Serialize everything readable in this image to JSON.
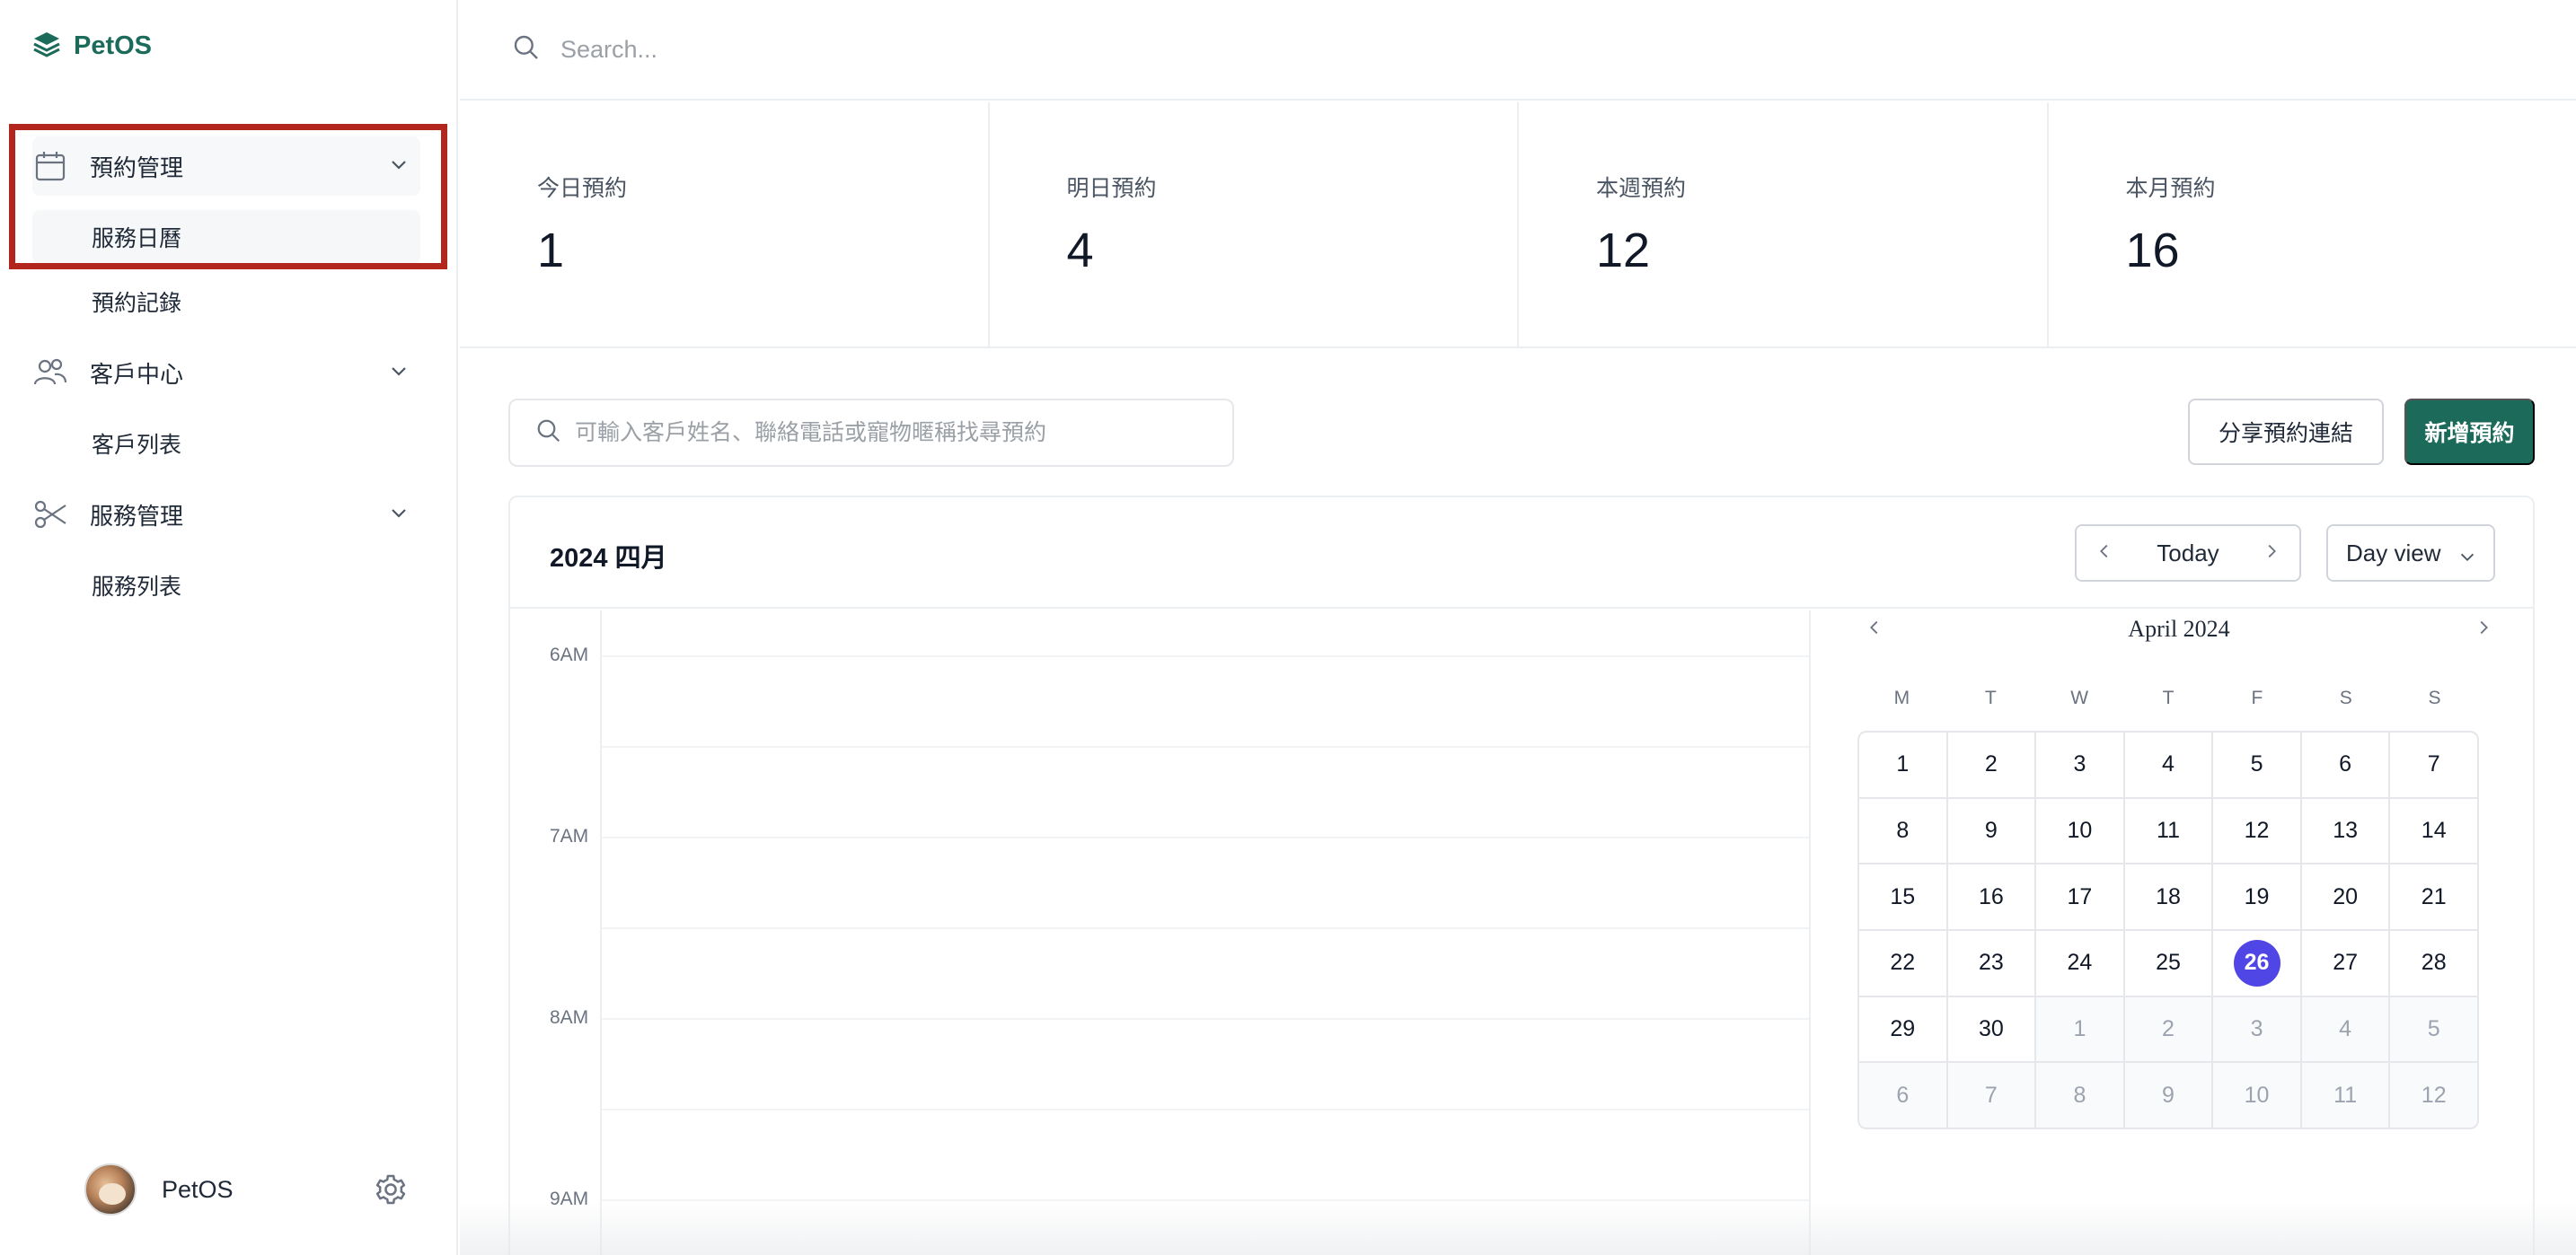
{
  "brand": {
    "name": "PetOS"
  },
  "sidebar": {
    "groups": [
      {
        "label": "預約管理",
        "items": [
          "服務日曆",
          "預約記錄"
        ]
      },
      {
        "label": "客戶中心",
        "items": [
          "客戶列表"
        ]
      },
      {
        "label": "服務管理",
        "items": [
          "服務列表"
        ]
      }
    ],
    "active_item": "服務日曆"
  },
  "user": {
    "name": "PetOS"
  },
  "topbar": {
    "search_placeholder": "Search..."
  },
  "stats": [
    {
      "label": "今日預約",
      "value": "1"
    },
    {
      "label": "明日預約",
      "value": "4"
    },
    {
      "label": "本週預約",
      "value": "12"
    },
    {
      "label": "本月預約",
      "value": "16"
    }
  ],
  "toolbar": {
    "search_placeholder": "可輸入客戶姓名、聯絡電話或寵物暱稱找尋預約",
    "share_label": "分享預約連結",
    "new_label": "新增預約"
  },
  "calendar": {
    "title": "2024 四月",
    "today_label": "Today",
    "view_label": "Day view",
    "time_labels": [
      "6AM",
      "7AM",
      "8AM",
      "9AM"
    ],
    "mini": {
      "title": "April 2024",
      "weekdays": [
        "M",
        "T",
        "W",
        "T",
        "F",
        "S",
        "S"
      ],
      "selected_day": "26",
      "weeks": [
        [
          "1",
          "2",
          "3",
          "4",
          "5",
          "6",
          "7"
        ],
        [
          "8",
          "9",
          "10",
          "11",
          "12",
          "13",
          "14"
        ],
        [
          "15",
          "16",
          "17",
          "18",
          "19",
          "20",
          "21"
        ],
        [
          "22",
          "23",
          "24",
          "25",
          "26",
          "27",
          "28"
        ],
        [
          "29",
          "30",
          "1",
          "2",
          "3",
          "4",
          "5"
        ],
        [
          "6",
          "7",
          "8",
          "9",
          "10",
          "11",
          "12"
        ]
      ]
    }
  },
  "colors": {
    "brand": "#1c6b5a",
    "selected_day": "#4f46e5",
    "highlight": "#b3261e"
  }
}
